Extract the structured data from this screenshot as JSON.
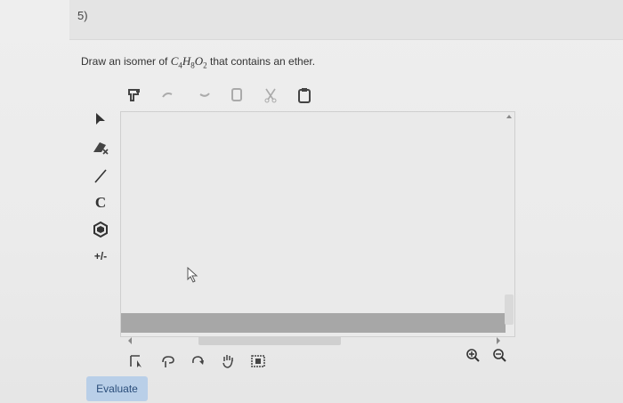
{
  "question": {
    "number": "5)",
    "prompt_before": "Draw an isomer of ",
    "formula": {
      "c": "C",
      "c_sub": "4",
      "h": "H",
      "h_sub": "8",
      "o": "O",
      "o_sub": "2"
    },
    "prompt_after": " that contains an ether."
  },
  "editor": {
    "top_toolbar": [
      "template-icon",
      "undo-icon",
      "redo-icon",
      "copy-icon",
      "cut-icon",
      "paste-icon"
    ],
    "left_toolbar": {
      "select": "select-arrow-icon",
      "eraser": "eraser-icon",
      "bond": "single-bond-icon",
      "carbon_label": "C",
      "ring": "ring-icon",
      "charge_label": "+/-"
    },
    "bottom_toolbar": [
      "select-all-icon",
      "lasso-icon",
      "rotate-icon",
      "hand-icon",
      "fit-icon"
    ],
    "zoom": [
      "zoom-in-icon",
      "zoom-out-icon"
    ]
  },
  "actions": {
    "evaluate_label": "Evaluate"
  }
}
